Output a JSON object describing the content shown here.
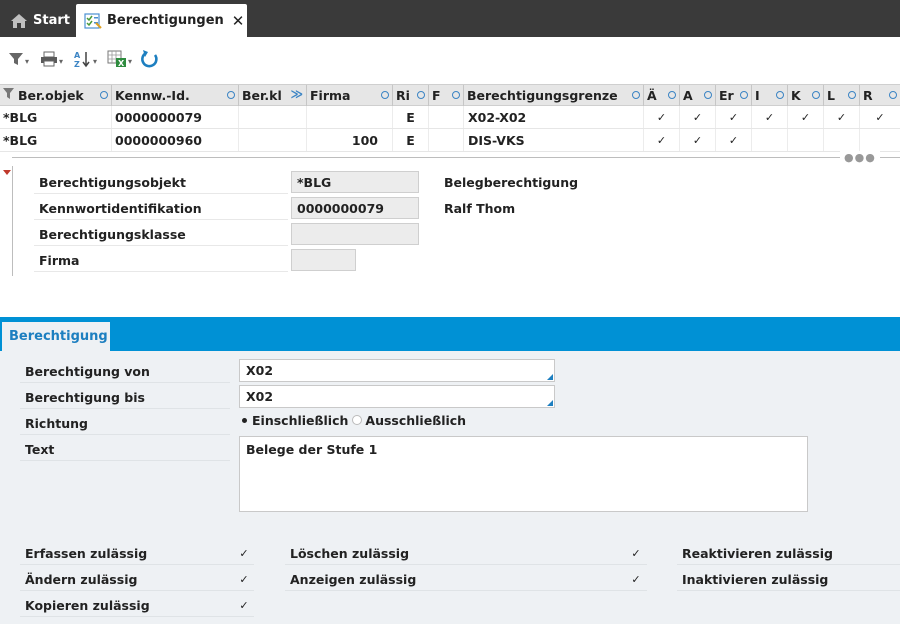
{
  "tabs": {
    "start_label": "Start",
    "active_label": "Berechtigungen",
    "close_glyph": "✕"
  },
  "toolbar": {
    "icons": [
      "filter-icon",
      "print-icon",
      "sort-az-icon",
      "excel-export-icon",
      "refresh-icon"
    ]
  },
  "grid": {
    "columns": [
      "Ber.objek",
      "Kennw.-Id.",
      "Ber.kl",
      "Firma",
      "Ri",
      "F",
      "Berechtigungsgrenze",
      "Ä",
      "A",
      "Er",
      "I",
      "K",
      "L",
      "R"
    ],
    "rows": [
      {
        "objekt": "*BLG",
        "kennw": "0000000079",
        "berkl": "",
        "firma": "",
        "ri": "E",
        "f": "",
        "grenze": "X02-X02",
        "checks": [
          true,
          true,
          true,
          true,
          true,
          true,
          true
        ]
      },
      {
        "objekt": "*BLG",
        "kennw": "0000000960",
        "berkl": "",
        "firma": "100",
        "ri": "E",
        "f": "",
        "grenze": "DIS-VKS",
        "checks": [
          true,
          true,
          true,
          false,
          false,
          false,
          false
        ]
      }
    ],
    "check_glyph": "✓"
  },
  "detail": {
    "objekt_label": "Berechtigungsobjekt",
    "objekt_value": "*BLG",
    "objekt_desc": "Belegberechtigung",
    "kennw_label": "Kennwortidentifikation",
    "kennw_value": "0000000079",
    "kennw_desc": "Ralf Thom",
    "klasse_label": "Berechtigungsklasse",
    "klasse_value": "",
    "firma_label": "Firma",
    "firma_value": ""
  },
  "section": {
    "tab_label": "Berechtigung",
    "von_label": "Berechtigung von",
    "von_value": "X02",
    "bis_label": "Berechtigung bis",
    "bis_value": "X02",
    "richtung_label": "Richtung",
    "radio_incl": "Einschließlich",
    "radio_excl": "Ausschließlich",
    "radio_selected": "Einschließlich",
    "text_label": "Text",
    "text_value": "Belege der Stufe 1"
  },
  "permissions": {
    "erfassen": "Erfassen zulässig",
    "aendern": "Ändern zulässig",
    "kopieren": "Kopieren zulässig",
    "loeschen": "Löschen zulässig",
    "anzeigen": "Anzeigen zulässig",
    "reaktivieren": "Reaktivieren zulässig",
    "inaktivieren": "Inaktivieren zulässig",
    "checked": {
      "erfassen": true,
      "aendern": true,
      "kopieren": true,
      "loeschen": true,
      "anzeigen": true,
      "reaktivieren": false,
      "inaktivieren": false
    }
  },
  "colors": {
    "accent": "#0091d5",
    "tabbar": "#3a3a3a"
  }
}
